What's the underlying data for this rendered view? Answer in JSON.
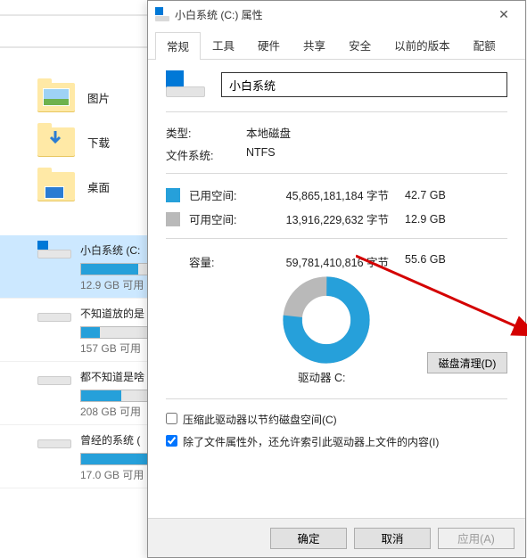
{
  "explorer": {
    "folders": [
      {
        "label": "图片",
        "kind": "pictures"
      },
      {
        "label": "下载",
        "kind": "downloads"
      },
      {
        "label": "桌面",
        "kind": "desktop"
      }
    ],
    "drives": [
      {
        "title": "小白系统 (C:",
        "sub": "12.9 GB 可用",
        "fill_pct": 78,
        "selected": true,
        "win": true
      },
      {
        "title": "不知道放的是",
        "sub": "157 GB 可用",
        "fill_pct": 25,
        "selected": false,
        "win": false
      },
      {
        "title": "都不知道是啥",
        "sub": "208 GB 可用",
        "fill_pct": 55,
        "selected": false,
        "win": false
      },
      {
        "title": "曾经的系统 (",
        "sub": "17.0 GB 可用",
        "fill_pct": 90,
        "selected": false,
        "win": false
      }
    ]
  },
  "dialog": {
    "title": "小白系统 (C:) 属性",
    "tabs": [
      "常规",
      "工具",
      "硬件",
      "共享",
      "安全",
      "以前的版本",
      "配额"
    ],
    "active_tab": 0,
    "drive_name": "小白系统",
    "type_label": "类型:",
    "type_value": "本地磁盘",
    "fs_label": "文件系统:",
    "fs_value": "NTFS",
    "used": {
      "label": "已用空间:",
      "bytes": "45,865,181,184 字节",
      "gb": "42.7 GB"
    },
    "free": {
      "label": "可用空间:",
      "bytes": "13,916,229,632 字节",
      "gb": "12.9 GB"
    },
    "capacity": {
      "label": "容量:",
      "bytes": "59,781,410,816 字节",
      "gb": "55.6 GB"
    },
    "drive_letter_label": "驱动器 C:",
    "cleanup_button": "磁盘清理(D)",
    "check_compress": "压缩此驱动器以节约磁盘空间(C)",
    "check_index": "除了文件属性外，还允许索引此驱动器上文件的内容(I)",
    "check_compress_checked": false,
    "check_index_checked": true,
    "footer": {
      "ok": "确定",
      "cancel": "取消",
      "apply": "应用(A)"
    }
  },
  "chart_data": {
    "type": "pie",
    "title": "驱动器 C:",
    "series": [
      {
        "name": "已用空间",
        "value": 45865181184,
        "display": "42.7 GB",
        "color": "#26a0da"
      },
      {
        "name": "可用空间",
        "value": 13916229632,
        "display": "12.9 GB",
        "color": "#b9b9b9"
      }
    ],
    "total": {
      "name": "容量",
      "value": 59781410816,
      "display": "55.6 GB"
    },
    "used_fraction": 0.767
  }
}
